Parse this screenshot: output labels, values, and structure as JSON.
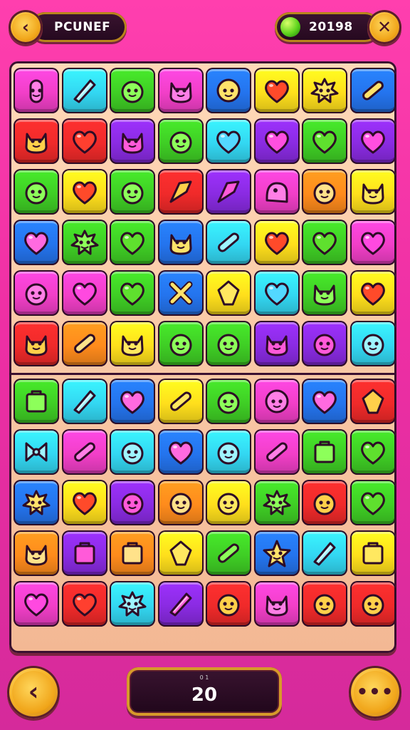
{
  "header": {
    "back_icon": "‹",
    "title": "PCUNEF",
    "score": "20198",
    "gem_icon": "green-gem-icon",
    "close_icon": "✕"
  },
  "footer": {
    "prev_icon": "‹",
    "counter_caption": "0 1",
    "counter_value": "20",
    "more_icon": "•••"
  },
  "colors": {
    "magenta": "#f23fc8",
    "cyan": "#33d7f2",
    "green": "#3fce25",
    "yellow": "#ffdf1c",
    "blue": "#2474ee",
    "purple": "#8a2be2",
    "red": "#f02a2a",
    "orange": "#ff8b1c"
  },
  "board": {
    "rows": [
      [
        [
          "magenta",
          "cactus"
        ],
        [
          "cyan",
          "blade"
        ],
        [
          "green",
          "blob"
        ],
        [
          "magenta",
          "cat"
        ],
        [
          "blue",
          "smile"
        ],
        [
          "yellow",
          "heart"
        ],
        [
          "yellow",
          "splat"
        ],
        [
          "blue",
          "bar"
        ]
      ],
      [
        [
          "red",
          "cat"
        ],
        [
          "red",
          "heart"
        ],
        [
          "purple",
          "cat"
        ],
        [
          "green",
          "blob"
        ],
        [
          "cyan",
          "heart"
        ],
        [
          "purple",
          "heart"
        ],
        [
          "green",
          "heart"
        ],
        [
          "purple",
          "heart"
        ]
      ],
      [
        [
          "green",
          "blob"
        ],
        [
          "yellow",
          "heart"
        ],
        [
          "green",
          "blob"
        ],
        [
          "red",
          "shard"
        ],
        [
          "purple",
          "shard"
        ],
        [
          "magenta",
          "ghost"
        ],
        [
          "orange",
          "blob"
        ],
        [
          "yellow",
          "cat"
        ]
      ],
      [
        [
          "blue",
          "heart"
        ],
        [
          "green",
          "splat"
        ],
        [
          "green",
          "heart"
        ],
        [
          "blue",
          "cat"
        ],
        [
          "cyan",
          "bar"
        ],
        [
          "yellow",
          "heart"
        ],
        [
          "green",
          "heart"
        ],
        [
          "magenta",
          "heart"
        ]
      ],
      [
        [
          "magenta",
          "blob"
        ],
        [
          "magenta",
          "heart"
        ],
        [
          "green",
          "heart"
        ],
        [
          "blue",
          "cross"
        ],
        [
          "yellow",
          "gem"
        ],
        [
          "cyan",
          "heart"
        ],
        [
          "green",
          "cat"
        ],
        [
          "yellow",
          "heart"
        ]
      ],
      [
        [
          "red",
          "cat"
        ],
        [
          "orange",
          "bar"
        ],
        [
          "yellow",
          "cat"
        ],
        [
          "green",
          "blob"
        ],
        [
          "green",
          "blob"
        ],
        [
          "purple",
          "cat"
        ],
        [
          "purple",
          "blob"
        ],
        [
          "cyan",
          "blob"
        ]
      ],
      [
        [
          "green",
          "box"
        ],
        [
          "cyan",
          "blade"
        ],
        [
          "blue",
          "heart"
        ],
        [
          "yellow",
          "bar"
        ],
        [
          "green",
          "blob"
        ],
        [
          "magenta",
          "smile"
        ],
        [
          "blue",
          "heart"
        ],
        [
          "red",
          "gem"
        ]
      ],
      [
        [
          "cyan",
          "bow"
        ],
        [
          "magenta",
          "bar"
        ],
        [
          "cyan",
          "blob"
        ],
        [
          "blue",
          "heart"
        ],
        [
          "cyan",
          "blob"
        ],
        [
          "magenta",
          "bar"
        ],
        [
          "green",
          "box"
        ],
        [
          "green",
          "heart"
        ]
      ],
      [
        [
          "blue",
          "splat"
        ],
        [
          "yellow",
          "heart"
        ],
        [
          "purple",
          "blob"
        ],
        [
          "orange",
          "blob"
        ],
        [
          "yellow",
          "blob"
        ],
        [
          "green",
          "splat"
        ],
        [
          "red",
          "blob"
        ],
        [
          "green",
          "heart"
        ]
      ],
      [
        [
          "orange",
          "cat"
        ],
        [
          "purple",
          "box"
        ],
        [
          "orange",
          "box"
        ],
        [
          "yellow",
          "gem"
        ],
        [
          "green",
          "bar"
        ],
        [
          "blue",
          "star"
        ],
        [
          "cyan",
          "blade"
        ],
        [
          "yellow",
          "box"
        ]
      ],
      [
        [
          "magenta",
          "heart"
        ],
        [
          "red",
          "heart"
        ],
        [
          "cyan",
          "splat"
        ],
        [
          "purple",
          "blade"
        ],
        [
          "red",
          "blob"
        ],
        [
          "magenta",
          "cat"
        ],
        [
          "red",
          "blob"
        ],
        [
          "red",
          "blob"
        ]
      ]
    ]
  }
}
